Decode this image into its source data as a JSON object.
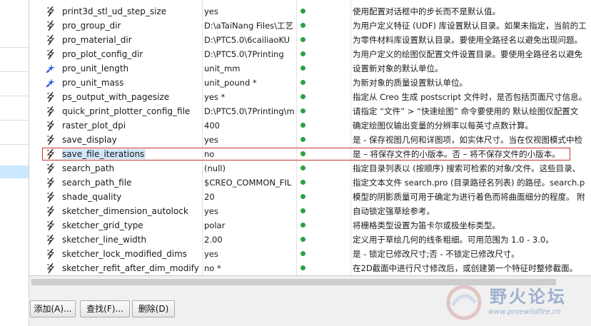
{
  "rows": [
    {
      "icon": "lightning-icon",
      "name": "print3d_stl_ud_step_size",
      "value": "yes",
      "desc": "使用配置对话框中的步长而不是默认值。"
    },
    {
      "icon": "lightning-icon",
      "name": "pro_group_dir",
      "value": "D:\\aTaiNang Files\\工艺",
      "desc": "为用户定义特征 (UDF) 库设置默认目录。如果未指定，当前的工"
    },
    {
      "icon": "lightning-icon",
      "name": "pro_material_dir",
      "value": "D:\\PTC5.0\\6cailiaoKU",
      "desc": "为零件材料库设置默认目录。要使用全路径名以避免出现问题。"
    },
    {
      "icon": "lightning-icon",
      "name": "pro_plot_config_dir",
      "value": "D:\\PTC5.0\\7Printing",
      "desc": "为用户定义的绘图仪配置文件设置目录。要使用全路径名以避免"
    },
    {
      "icon": "star-icon",
      "name": "pro_unit_length",
      "value": "unit_mm",
      "desc": "设置新对象的默认单位。"
    },
    {
      "icon": "star-icon",
      "name": "pro_unit_mass",
      "value": "unit_pound *",
      "desc": "为新对象的质量设置默认单位。"
    },
    {
      "icon": "lightning-icon",
      "name": "ps_output_with_pagesize",
      "value": "yes *",
      "desc": "指定从 Creo 生成 postscript 文件时，是否包括页面尺寸信息。"
    },
    {
      "icon": "lightning-icon",
      "name": "quick_print_plotter_config_file",
      "value": "D:\\PTC5.0\\7Printing\\m",
      "desc": "请指定 “文件” > “快速绘图” 命令要使用的 默认绘图仪配置文"
    },
    {
      "icon": "lightning-icon",
      "name": "raster_plot_dpi",
      "value": "400",
      "desc": "确定绘图仪输出变量的分辨率以每英寸点数计算。"
    },
    {
      "icon": "lightning-icon",
      "name": "save_display",
      "value": "yes",
      "desc": "是 - 保存视图几何和详图项，如实体尺寸。当在仅视图模式中检"
    },
    {
      "icon": "lightning-icon",
      "name": "save_file_iterations",
      "value": "no",
      "desc": "是 – 将保存文件的小版本。否 – 将不保存文件的小版本。"
    },
    {
      "icon": "lightning-icon",
      "name": "search_path",
      "value": "(null)",
      "desc": "指定目录列表以 (按顺序) 搜索可检索的对象/文件。这些目录、"
    },
    {
      "icon": "lightning-icon",
      "name": "search_path_file",
      "value": "$CREO_COMMON_FIL",
      "desc": "指定文本文件 search.pro (目录路径名列表) 的路径。search.p"
    },
    {
      "icon": "lightning-icon",
      "name": "shade_quality",
      "value": "20",
      "desc": "模型的阴影质量可用于确定为进行着色而将曲面细分的程度。 附"
    },
    {
      "icon": "lightning-icon",
      "name": "sketcher_dimension_autolock",
      "value": "yes",
      "desc": "自动锁定强草绘参考。"
    },
    {
      "icon": "lightning-icon",
      "name": "sketcher_grid_type",
      "value": "polar",
      "desc": "将栅格类型设置为笛卡尔或极坐标类型。"
    },
    {
      "icon": "lightning-icon",
      "name": "sketcher_line_width",
      "value": "2.00",
      "desc": "定义用于草绘几何的线条粗细。可用范围为 1.0 - 3.0。"
    },
    {
      "icon": "lightning-icon",
      "name": "sketcher_lock_modified_dims",
      "value": "yes",
      "desc": "是 - 锁定已修改尺寸;否 - 不锁定已修改尺寸。"
    },
    {
      "icon": "lightning-icon",
      "name": "sketcher_refit_after_dim_modify",
      "value": "no *",
      "desc": "在2D截面中进行尺寸修改后，或创建第一个特征时整修截面。"
    }
  ],
  "selected_row": 10,
  "buttons": {
    "add": "添加(A)...",
    "find": "查找(F)...",
    "delete": "删除(D)"
  },
  "watermark": {
    "title": "野火论坛",
    "url": "www.proewildfire.cn"
  },
  "colors": {
    "status_dot": "#2ea043",
    "highlight_border": "#c8342f",
    "selection": "#cfe4f7"
  }
}
